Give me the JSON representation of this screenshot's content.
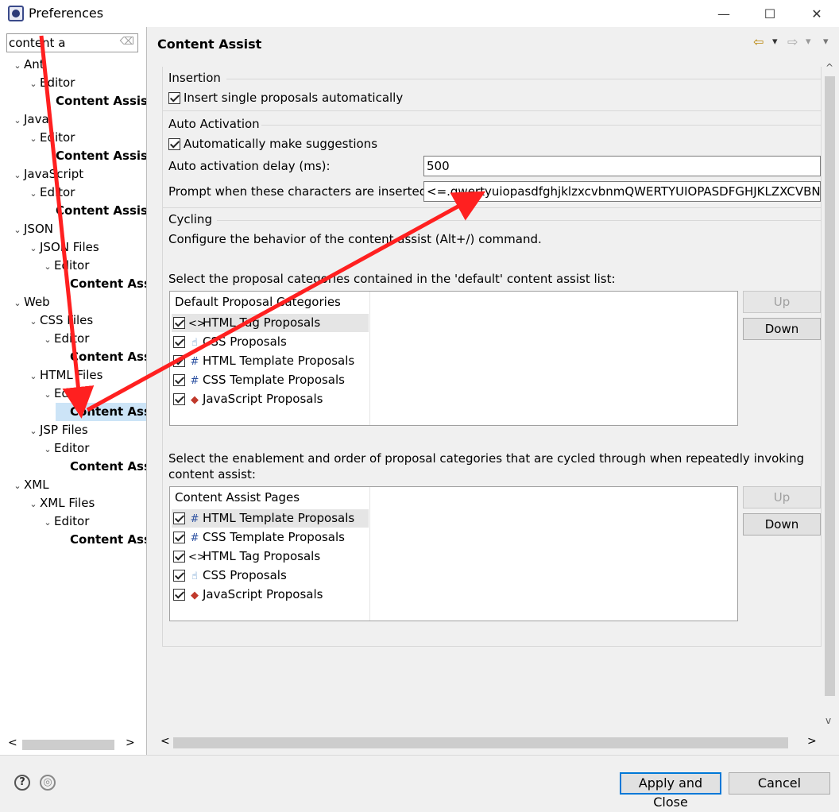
{
  "window": {
    "title": "Preferences",
    "controls": {
      "minimize": "—",
      "maximize": "☐",
      "close": "✕"
    }
  },
  "filter": {
    "value": "content a",
    "clear_glyph": "⌫"
  },
  "tree": [
    {
      "label": "Ant",
      "level": 0,
      "twisty": "⌄"
    },
    {
      "label": "Editor",
      "level": 1,
      "twisty": "⌄"
    },
    {
      "label": "Content Assist",
      "level": 2,
      "bold": true
    },
    {
      "label": "Java",
      "level": 0,
      "twisty": "⌄"
    },
    {
      "label": "Editor",
      "level": 1,
      "twisty": "⌄"
    },
    {
      "label": "Content Assist",
      "level": 2,
      "bold": true
    },
    {
      "label": "JavaScript",
      "level": 0,
      "twisty": "⌄"
    },
    {
      "label": "Editor",
      "level": 1,
      "twisty": "⌄"
    },
    {
      "label": "Content Assist",
      "level": 2,
      "bold": true
    },
    {
      "label": "JSON",
      "level": 0,
      "twisty": "⌄"
    },
    {
      "label": "JSON Files",
      "level": 1,
      "twisty": "⌄"
    },
    {
      "label": "Editor",
      "level": 2,
      "twisty": "⌄"
    },
    {
      "label": "Content Assist",
      "level": 3,
      "bold": true
    },
    {
      "label": "Web",
      "level": 0,
      "twisty": "⌄"
    },
    {
      "label": "CSS Files",
      "level": 1,
      "twisty": "⌄"
    },
    {
      "label": "Editor",
      "level": 2,
      "twisty": "⌄"
    },
    {
      "label": "Content Assist",
      "level": 3,
      "bold": true
    },
    {
      "label": "HTML Files",
      "level": 1,
      "twisty": "⌄"
    },
    {
      "label": "Editor",
      "level": 2,
      "twisty": "⌄"
    },
    {
      "label": "Content Assist",
      "level": 3,
      "bold": true,
      "selected": true
    },
    {
      "label": "JSP Files",
      "level": 1,
      "twisty": "⌄"
    },
    {
      "label": "Editor",
      "level": 2,
      "twisty": "⌄"
    },
    {
      "label": "Content Assist",
      "level": 3,
      "bold": true
    },
    {
      "label": "XML",
      "level": 0,
      "twisty": "⌄"
    },
    {
      "label": "XML Files",
      "level": 1,
      "twisty": "⌄"
    },
    {
      "label": "Editor",
      "level": 2,
      "twisty": "⌄"
    },
    {
      "label": "Content Assist",
      "level": 3,
      "bold": true
    }
  ],
  "tree_scroll": {
    "left": "<",
    "right": ">"
  },
  "page": {
    "title": "Content Assist",
    "nav": {
      "back": "⇦",
      "back_menu": "▾",
      "forward": "⇨",
      "forward_menu": "▾",
      "view_menu": "▾"
    }
  },
  "insertion": {
    "title": "Insertion",
    "insert_single": {
      "label": "Insert single proposals automatically",
      "checked": true
    }
  },
  "auto_activation": {
    "title": "Auto Activation",
    "make_suggestions": {
      "label": "Automatically make suggestions",
      "checked": true
    },
    "delay_label": "Auto activation delay (ms):",
    "delay_value": "500",
    "prompt_label": "Prompt when these characters are inserted:",
    "prompt_value": "<=.qwertyuiopasdfghjklzxcvbnmQWERTYUIOPASDFGHJKLZXCVBNM"
  },
  "cycling": {
    "title": "Cycling",
    "description": "Configure the behavior of the content assist (Alt+/) command.",
    "default_list_label": "Select the proposal categories contained in the 'default' content assist list:",
    "default_list": {
      "header": "Default Proposal Categories",
      "items": [
        {
          "icon": "<>",
          "label": "HTML Tag Proposals",
          "checked": true,
          "highlight": true
        },
        {
          "icon": "☝",
          "label": "CSS Proposals",
          "checked": true
        },
        {
          "icon": "#",
          "label": "HTML Template Proposals",
          "checked": true
        },
        {
          "icon": "#",
          "label": "CSS Template Proposals",
          "checked": true
        },
        {
          "icon": "◆",
          "label": "JavaScript Proposals",
          "checked": true
        }
      ],
      "up": "Up",
      "down": "Down"
    },
    "pages_list_label": "Select the enablement and order of proposal categories that are cycled through when repeatedly invoking",
    "pages_list_label2": "content assist:",
    "pages_list": {
      "header": "Content Assist Pages",
      "items": [
        {
          "icon": "#",
          "label": "HTML Template Proposals",
          "checked": true,
          "highlight": true
        },
        {
          "icon": "#",
          "label": "CSS Template Proposals",
          "checked": true
        },
        {
          "icon": "<>",
          "label": "HTML Tag Proposals",
          "checked": true
        },
        {
          "icon": "☝",
          "label": "CSS Proposals",
          "checked": true
        },
        {
          "icon": "◆",
          "label": "JavaScript Proposals",
          "checked": true
        }
      ],
      "up": "Up",
      "down": "Down"
    }
  },
  "content_scroll": {
    "left": "<",
    "right": ">",
    "up": "^",
    "down": "v"
  },
  "footer": {
    "help_glyph": "?",
    "import_glyph": "◎",
    "apply_close": "Apply and Close",
    "cancel": "Cancel"
  },
  "colors": {
    "annotation": "#ff2020",
    "selection": "#cce4f7",
    "default_button_border": "#0078d7"
  }
}
